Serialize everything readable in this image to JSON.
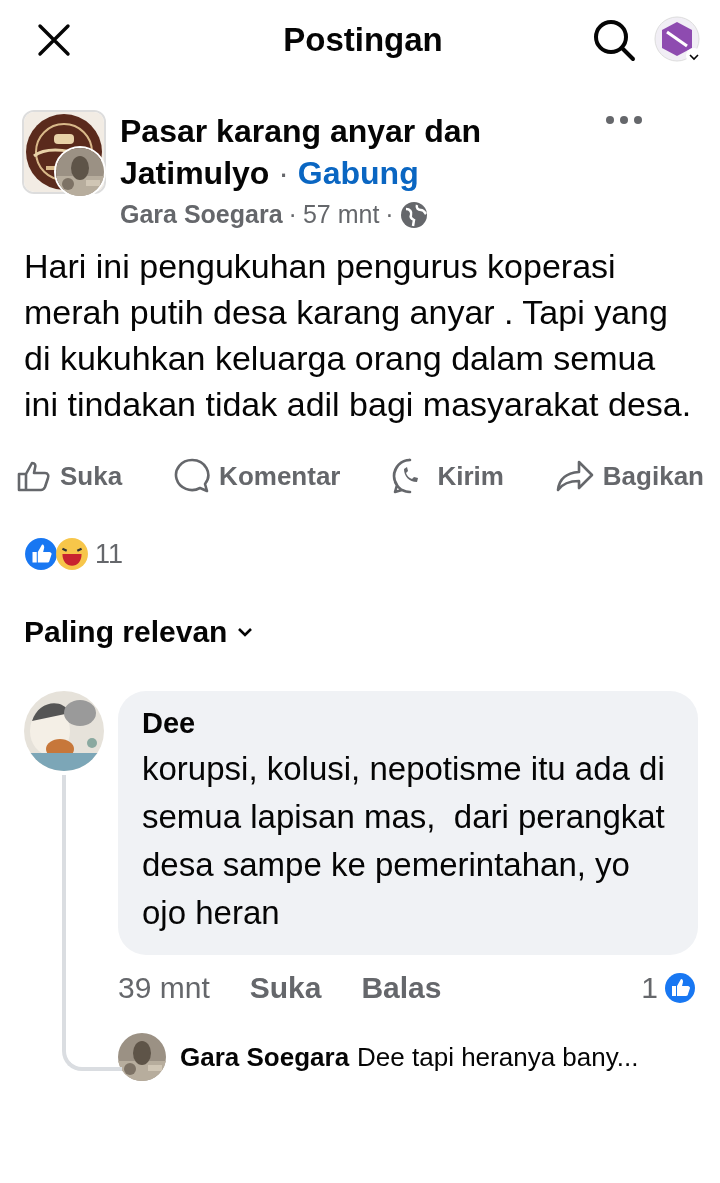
{
  "header": {
    "title": "Postingan"
  },
  "post": {
    "separator": "·",
    "group": "Pasar karang anyar dan Jatimulyo",
    "join": "Gabung",
    "author": "Gara Soegara",
    "time": "57 mnt",
    "text": "Hari ini pengukuhan pengurus koperasi merah putih desa karang anyar . Tapi yang di kukuhkan keluarga orang dalam semua  ini tindakan tidak adil bagi masyarakat desa."
  },
  "actions": [
    {
      "kind": "like",
      "label": "Suka"
    },
    {
      "kind": "comment",
      "label": "Komentar"
    },
    {
      "kind": "send",
      "label": "Kirim"
    },
    {
      "kind": "share",
      "label": "Bagikan"
    }
  ],
  "reactions": {
    "count": "11"
  },
  "sort": {
    "label": "Paling relevan"
  },
  "comments": [
    {
      "author": "Dee",
      "text": "korupsi, kolusi, nepotisme itu ada di semua lapisan mas,  dari perangkat desa sampe ke pemerintahan, yo ojo heran",
      "time": "39 mnt",
      "like": "Suka",
      "reply": "Balas",
      "likes": "1",
      "replies": [
        {
          "author": "Gara Soegara",
          "text": "Dee tapi heranya bany..."
        }
      ]
    }
  ]
}
